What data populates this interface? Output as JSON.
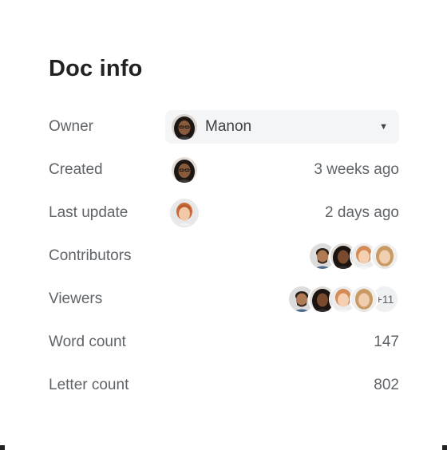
{
  "title": "Doc info",
  "rows": {
    "owner": {
      "label": "Owner",
      "value": "Manon"
    },
    "created": {
      "label": "Created",
      "value": "3 weeks ago"
    },
    "last_update": {
      "label": "Last update",
      "value": "2 days ago"
    },
    "contributors": {
      "label": "Contributors"
    },
    "viewers": {
      "label": "Viewers",
      "more": "+11"
    },
    "word_count": {
      "label": "Word count",
      "value": "147"
    },
    "letter_count": {
      "label": "Letter count",
      "value": "802"
    }
  },
  "icons": {
    "owner_caret": "caret-down-icon"
  },
  "colors": {
    "title": "#222222",
    "label": "#5f6368",
    "select_bg": "#f4f5f7"
  }
}
